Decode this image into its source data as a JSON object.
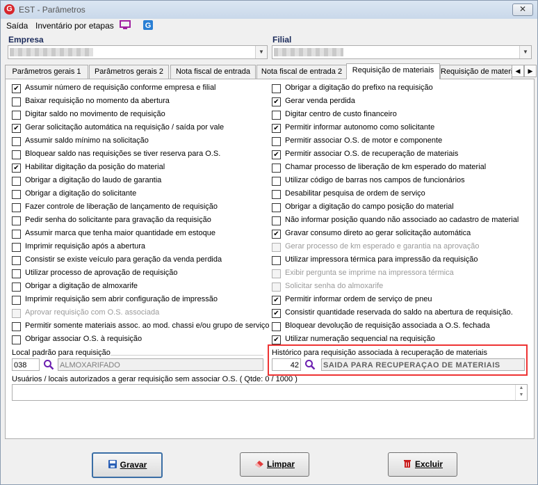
{
  "window": {
    "logo": "G",
    "title": "EST - Parâmetros",
    "close_glyph": "✕"
  },
  "menu": {
    "items": [
      "Saída",
      "Inventário por etapas"
    ]
  },
  "header": {
    "empresa_label": "Empresa",
    "filial_label": "Filial"
  },
  "tabs": [
    {
      "label": "Parâmetros gerais 1"
    },
    {
      "label": "Parâmetros gerais 2"
    },
    {
      "label": "Nota fiscal de entrada"
    },
    {
      "label": "Nota fiscal de entrada 2"
    },
    {
      "label": "Requisição de materiais",
      "active": true
    },
    {
      "label": "Requisição de materi"
    }
  ],
  "left_options": [
    {
      "label": "Assumir número de requisição conforme empresa e filial",
      "checked": true,
      "enabled": true
    },
    {
      "label": "Baixar requisição no momento da abertura",
      "checked": false,
      "enabled": true
    },
    {
      "label": "Digitar saldo no movimento de requisição",
      "checked": false,
      "enabled": true
    },
    {
      "label": "Gerar solicitação automática na requisição / saída por vale",
      "checked": true,
      "enabled": true
    },
    {
      "label": "Assumir saldo mínimo na solicitação",
      "checked": false,
      "enabled": true
    },
    {
      "label": "Bloquear saldo nas requisições se tiver reserva para O.S.",
      "checked": false,
      "enabled": true
    },
    {
      "label": "Habilitar digitação da posição do material",
      "checked": true,
      "enabled": true
    },
    {
      "label": "Obrigar a digitação do laudo de garantia",
      "checked": false,
      "enabled": true
    },
    {
      "label": "Obrigar a digitação do solicitante",
      "checked": false,
      "enabled": true
    },
    {
      "label": "Fazer controle de liberação de lançamento de requisição",
      "checked": false,
      "enabled": true
    },
    {
      "label": "Pedir senha do solicitante para gravação da requisição",
      "checked": false,
      "enabled": true
    },
    {
      "label": "Assumir marca que tenha maior quantidade em estoque",
      "checked": false,
      "enabled": true
    },
    {
      "label": "Imprimir requisição após a abertura",
      "checked": false,
      "enabled": true
    },
    {
      "label": "Consistir se existe veículo para geração da venda perdida",
      "checked": false,
      "enabled": true
    },
    {
      "label": "Utilizar processo de aprovação de requisição",
      "checked": false,
      "enabled": true
    },
    {
      "label": "Obrigar a digitação de almoxarife",
      "checked": false,
      "enabled": true
    },
    {
      "label": "Imprimir requisição sem abrir configuração de impressão",
      "checked": false,
      "enabled": true
    },
    {
      "label": "Aprovar requisição com O.S. associada",
      "checked": false,
      "enabled": false
    },
    {
      "label": "Permitir somente materiais assoc. ao mod. chassi e/ou grupo de serviço",
      "checked": false,
      "enabled": true
    },
    {
      "label": "Obrigar associar O.S. à requisição",
      "checked": false,
      "enabled": true
    }
  ],
  "right_options": [
    {
      "label": "Obrigar a digitação do prefixo na requisição",
      "checked": false,
      "enabled": true
    },
    {
      "label": "Gerar venda perdida",
      "checked": true,
      "enabled": true
    },
    {
      "label": "Digitar centro de custo financeiro",
      "checked": false,
      "enabled": true
    },
    {
      "label": "Permitir informar autonomo como solicitante",
      "checked": true,
      "enabled": true
    },
    {
      "label": "Permitir associar O.S. de motor e componente",
      "checked": false,
      "enabled": true
    },
    {
      "label": "Permitir associar O.S. de recuperação de materiais",
      "checked": true,
      "enabled": true
    },
    {
      "label": "Chamar processo de liberação de km esperado do material",
      "checked": false,
      "enabled": true
    },
    {
      "label": "Utilizar código de barras nos campos de funcionários",
      "checked": false,
      "enabled": true
    },
    {
      "label": "Desabilitar pesquisa de ordem de serviço",
      "checked": false,
      "enabled": true
    },
    {
      "label": "Obrigar a digitação do campo posição do material",
      "checked": false,
      "enabled": true
    },
    {
      "label": "Não informar posição quando não associado ao cadastro de material",
      "checked": false,
      "enabled": true
    },
    {
      "label": "Gravar consumo direto ao gerar solicitação automática",
      "checked": true,
      "enabled": true
    },
    {
      "label": "Gerar processo de km esperado e garantia na aprovação",
      "checked": false,
      "enabled": false
    },
    {
      "label": "Utilizar impressora térmica para impressão da requisição",
      "checked": false,
      "enabled": true
    },
    {
      "label": "Exibir pergunta se imprime na impressora térmica",
      "checked": false,
      "enabled": false
    },
    {
      "label": "Solicitar senha do almoxarife",
      "checked": false,
      "enabled": false
    },
    {
      "label": "Permitir informar ordem de serviço de pneu",
      "checked": true,
      "enabled": true
    },
    {
      "label": "Consistir quantidade reservada do saldo na abertura de requisição.",
      "checked": true,
      "enabled": true
    },
    {
      "label": "Bloquear devolução de requisição associada a O.S. fechada",
      "checked": false,
      "enabled": true
    },
    {
      "label": "Utilizar numeração sequencial na requisição",
      "checked": true,
      "enabled": true
    }
  ],
  "local": {
    "label": "Local padrão para requisição",
    "code": "038",
    "description": "ALMOXARIFADO"
  },
  "historico": {
    "label": "Histórico para requisição associada à recuperação de materiais",
    "code": "42",
    "description": "SAIDA PARA RECUPERAÇAO DE MATERIAIS"
  },
  "usuarios": {
    "label": "Usuários / locais autorizados a gerar requisição sem associar O.S.  ( Qtde: 0 / 1000 )"
  },
  "buttons": {
    "gravar": "Gravar",
    "limpar": "Limpar",
    "excluir": "Excluir"
  },
  "colors": {
    "highlight_border": "#e33333",
    "accent": "#3a6ea5"
  }
}
